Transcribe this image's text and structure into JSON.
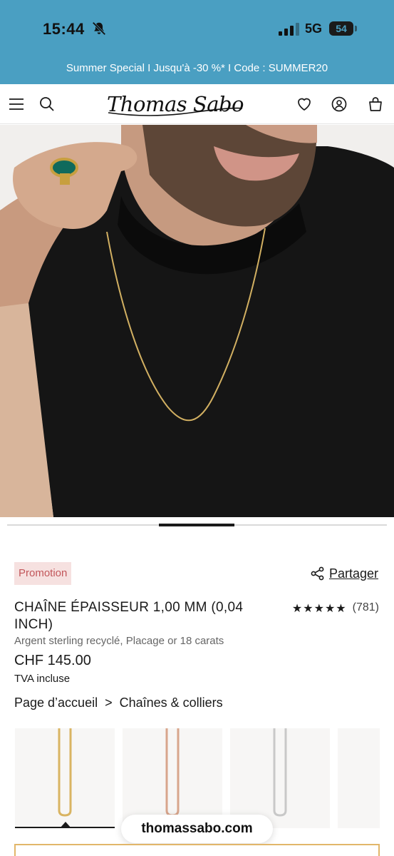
{
  "status_bar": {
    "time": "15:44",
    "network": "5G",
    "battery": "54"
  },
  "promo_banner": {
    "text": "Summer Special I Jusqu'à -30 %* I Code : SUMMER20"
  },
  "header": {
    "logo_text": "Thomas Sabo",
    "icons": [
      "menu-icon",
      "search-icon",
      "heart-icon",
      "account-icon",
      "bag-icon"
    ]
  },
  "gallery": {
    "progress": 0.2
  },
  "product": {
    "badge": "Promotion",
    "share_label": "Partager",
    "title": "CHAÎNE ÉPAISSEUR 1,00 MM (0,04 INCH)",
    "stars": "★★★★★",
    "rating_count": "(781)",
    "subtitle": "Argent sterling recyclé, Placage or 18 carats",
    "price": "CHF 145.00",
    "vat": "TVA incluse"
  },
  "breadcrumb": {
    "home": "Page d’accueil",
    "separator": ">",
    "category": "Chaînes & colliers"
  },
  "variants": [
    {
      "color": "gold",
      "hex": "#d9b462",
      "selected": true
    },
    {
      "color": "rose-gold",
      "hex": "#d8a58c",
      "selected": false
    },
    {
      "color": "silver",
      "hex": "#c8c8c8",
      "selected": false
    }
  ],
  "browser": {
    "url": "thomassabo.com"
  },
  "colors": {
    "status_blue": "#4a9fc2",
    "badge_bg": "#f6e1e0",
    "badge_text": "#c2565a",
    "cta_border": "#e2b66a"
  }
}
